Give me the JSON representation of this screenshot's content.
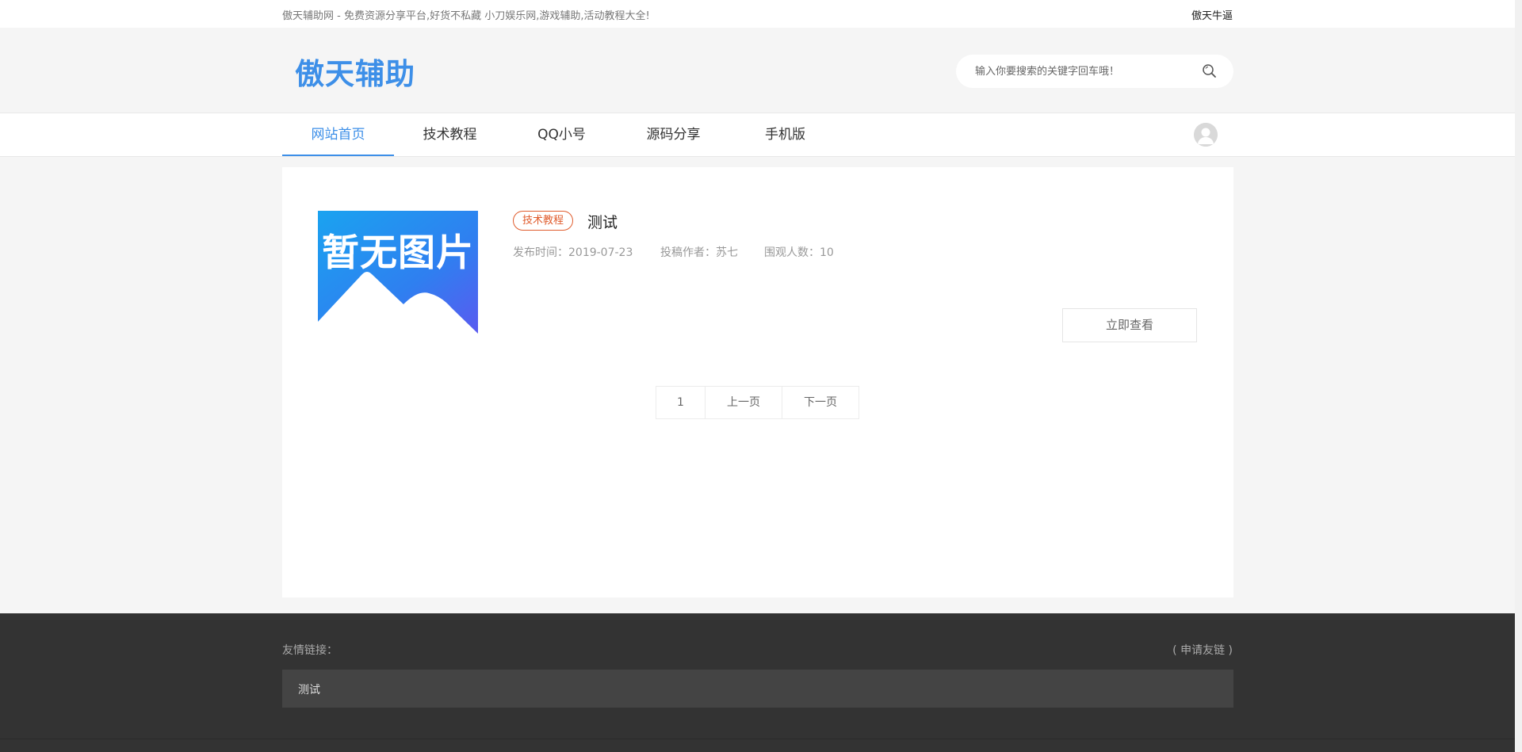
{
  "topbar": {
    "slogan": "傲天辅助网 - 免费资源分享平台,好货不私藏 小刀娱乐网,游戏辅助,活动教程大全!",
    "brand_link": "傲天牛逼"
  },
  "header": {
    "logo": "傲天辅助",
    "search_placeholder": "输入你要搜索的关键字回车哦！"
  },
  "nav": {
    "items": [
      {
        "label": "网站首页",
        "active": true
      },
      {
        "label": "技术教程"
      },
      {
        "label": "QQ小号"
      },
      {
        "label": "源码分享"
      },
      {
        "label": "手机版"
      }
    ]
  },
  "post": {
    "thumb_text": "暂无图片",
    "tag": "技术教程",
    "title": "测试",
    "publish_time": "发布时间：2019-07-23",
    "author": "投稿作者：苏七",
    "views": "围观人数：10",
    "view_button": "立即查看"
  },
  "pager": {
    "current": "1",
    "prev": "上一页",
    "next": "下一页"
  },
  "footer": {
    "links_title": "友情链接：",
    "apply": "( 申请友链 )",
    "links": [
      "测试"
    ]
  },
  "colors": {
    "accent": "#3d8fe8",
    "tag": "#e05c2d",
    "footer_bg": "#333333"
  }
}
